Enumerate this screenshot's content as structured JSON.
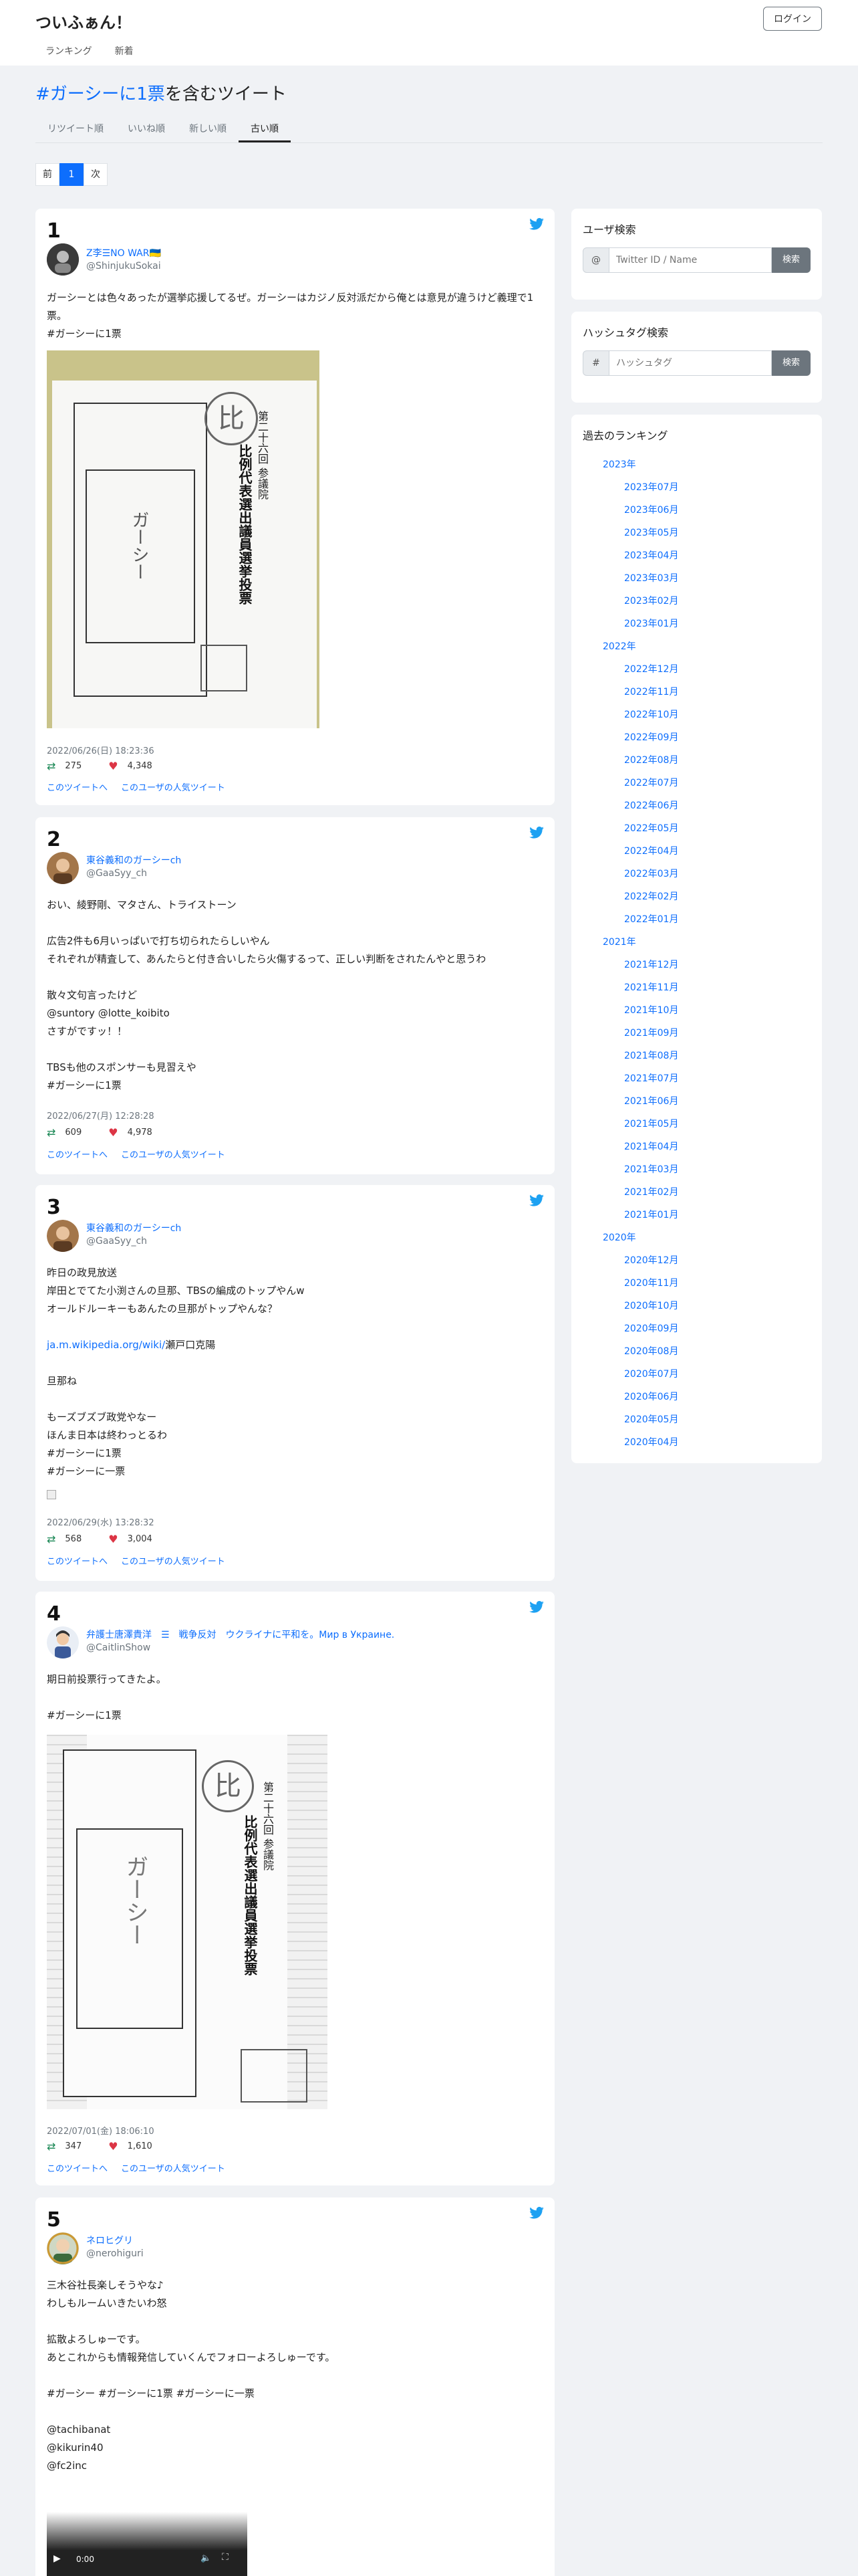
{
  "brand": "ついふぁん！",
  "login_label": "ログイン",
  "nav": [
    "ランキング",
    "新着"
  ],
  "heading": {
    "hashtag": "#ガーシーに1票",
    "suffix": "を含むツイート"
  },
  "sort_tabs": [
    "リツイート順",
    "いいね順",
    "新しい順",
    "古い順"
  ],
  "pager": {
    "prev": "前",
    "current": "1",
    "next": "次"
  },
  "tweets": [
    {
      "num": "1",
      "name": "Z李☰NO WAR🇺🇦",
      "handle": "@ShinjukuSokai",
      "text": "ガーシーとは色々あったが選挙応援してるぜ。ガーシーはカジノ反対派だから俺とは意見が違うけど義理で1票。",
      "tags": "#ガーシーに1票",
      "date": "2022/06/26(日) 18:23:36",
      "retweets": "275",
      "likes": "4,348",
      "link1": "このツイートへ",
      "link2": "このユーザの人気ツイート",
      "ballot": {
        "title": "第二十六回 参議院",
        "big": "比例代表選出議員選挙投票",
        "write": "ガーシー"
      }
    },
    {
      "num": "2",
      "name": "東谷義和のガーシーch",
      "handle": "@GaaSyy_ch",
      "text": "おい、綾野剛、マタさん、トライストーン\n\n広告2件も6月いっぱいで打ち切られたらしいやん\nそれぞれが精査して、あんたらと付き合いしたら火傷するって、正しい判断をされたんやと思うわ\n\n散々文句言ったけど",
      "mentions": "@suntory @lotte_koibito",
      "text2": "さすがですッ！！\n\nTBSも他のスポンサーも見習えや",
      "tags": "#ガーシーに1票",
      "date": "2022/06/27(月) 12:28:28",
      "retweets": "609",
      "likes": "4,978",
      "link1": "このツイートへ",
      "link2": "このユーザの人気ツイート"
    },
    {
      "num": "3",
      "name": "東谷義和のガーシーch",
      "handle": "@GaaSyy_ch",
      "text": "昨日の政見放送\n岸田とでてた小渕さんの旦那、TBSの編成のトップやんw\nオールドルーキーもあんたの旦那がトップやんな？",
      "url": "ja.m.wikipedia.org/wiki/",
      "url_suffix": "瀬戸口克陽",
      "text2": "旦那ね\n\nもーズブズブ政党やなー\nほんま日本は終わっとるわ",
      "tags": "#ガーシーに1票",
      "tags2": "#ガーシーに一票",
      "date": "2022/06/29(水) 13:28:32",
      "retweets": "568",
      "likes": "3,004",
      "link1": "このツイートへ",
      "link2": "このユーザの人気ツイート"
    },
    {
      "num": "4",
      "name": "弁護士唐澤貴洋　☰　戦争反対　ウクライナに平和を。Мир в Украине.",
      "handle": "@CaitlinShow",
      "text": "期日前投票行ってきたよ。",
      "tags": "#ガーシーに1票",
      "date": "2022/07/01(金) 18:06:10",
      "retweets": "347",
      "likes": "1,610",
      "link1": "このツイートへ",
      "link2": "このユーザの人気ツイート",
      "ballot": {
        "title": "第二十六回 参議院",
        "big": "比例代表選出議員選挙投票",
        "write": "ガーシー"
      }
    },
    {
      "num": "5",
      "name": "ネロヒグリ",
      "handle": "@nerohiguri",
      "text": "三木谷社長楽しそうやな♪\nわしもルームいきたいわ怒\n\n拡散よろしゅーです。\nあとこれからも情報発信していくんでフォローよろしゅーです。",
      "tags": "#ガーシー #ガーシーに1票 #ガーシーに一票",
      "mentions": [
        "@tachibanat",
        "@kikurin40",
        "@fc2inc"
      ],
      "video_time": "0:00"
    }
  ],
  "sidebar": {
    "user_search": {
      "title": "ユーザ検索",
      "prefix": "@",
      "placeholder": "Twitter ID / Name",
      "button": "検索"
    },
    "tag_search": {
      "title": "ハッシュタグ検索",
      "prefix": "#",
      "placeholder": "ハッシュタグ",
      "button": "検索"
    },
    "ranking": {
      "title": "過去のランキング",
      "years": [
        {
          "year": "2023年",
          "months": [
            "2023年07月",
            "2023年06月",
            "2023年05月",
            "2023年04月",
            "2023年03月",
            "2023年02月",
            "2023年01月"
          ]
        },
        {
          "year": "2022年",
          "months": [
            "2022年12月",
            "2022年11月",
            "2022年10月",
            "2022年09月",
            "2022年08月",
            "2022年07月",
            "2022年06月",
            "2022年05月",
            "2022年04月",
            "2022年03月",
            "2022年02月",
            "2022年01月"
          ]
        },
        {
          "year": "2021年",
          "months": [
            "2021年12月",
            "2021年11月",
            "2021年10月",
            "2021年09月",
            "2021年08月",
            "2021年07月",
            "2021年06月",
            "2021年05月",
            "2021年04月",
            "2021年03月",
            "2021年02月",
            "2021年01月"
          ]
        },
        {
          "year": "2020年",
          "months": [
            "2020年12月",
            "2020年11月",
            "2020年10月",
            "2020年09月",
            "2020年08月",
            "2020年07月",
            "2020年06月",
            "2020年05月",
            "2020年04月"
          ]
        }
      ]
    }
  },
  "colors": {
    "link": "#0d6efd",
    "retweet": "#198754",
    "like": "#dc3545",
    "twitter": "#1da1f2"
  }
}
